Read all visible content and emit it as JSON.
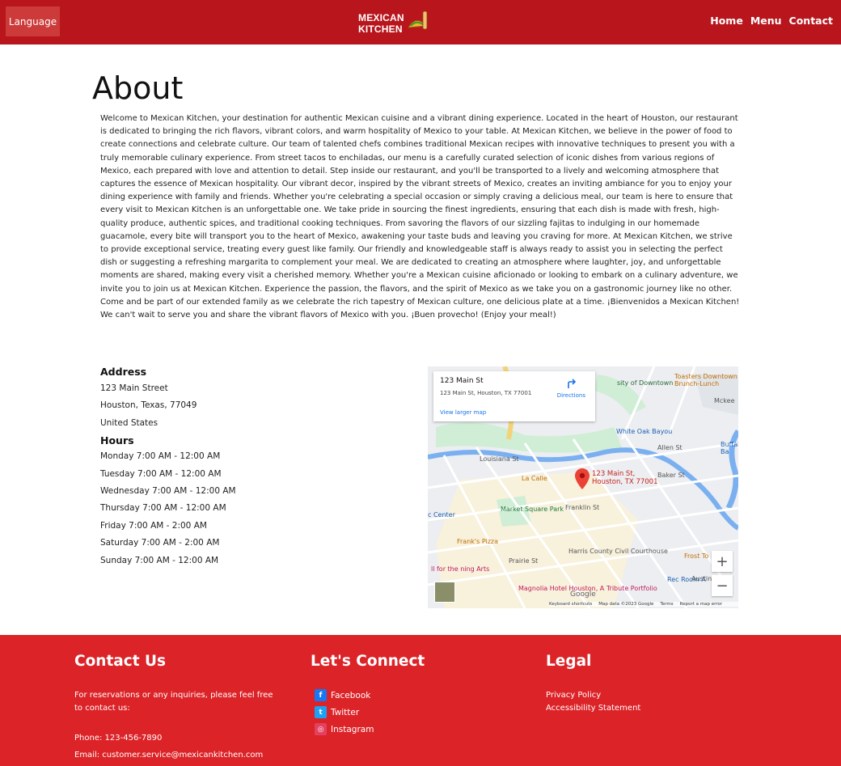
{
  "nav": {
    "language_label": "Language",
    "logo_line1": "MEXICAN",
    "logo_line2": "KITCHEN",
    "links": [
      "Home",
      "Menu",
      "Contact"
    ]
  },
  "about": {
    "title": "About",
    "body": "Welcome to Mexican Kitchen, your destination for authentic Mexican cuisine and a vibrant dining experience. Located in the heart of Houston, our restaurant is dedicated to bringing the rich flavors, vibrant colors, and warm hospitality of Mexico to your table. At Mexican Kitchen, we believe in the power of food to create connections and celebrate culture. Our team of talented chefs combines traditional Mexican recipes with innovative techniques to present you with a truly memorable culinary experience. From street tacos to enchiladas, our menu is a carefully curated selection of iconic dishes from various regions of Mexico, each prepared with love and attention to detail. Step inside our restaurant, and you'll be transported to a lively and welcoming atmosphere that captures the essence of Mexican hospitality. Our vibrant decor, inspired by the vibrant streets of Mexico, creates an inviting ambiance for you to enjoy your dining experience with family and friends. Whether you're celebrating a special occasion or simply craving a delicious meal, our team is here to ensure that every visit to Mexican Kitchen is an unforgettable one. We take pride in sourcing the finest ingredients, ensuring that each dish is made with fresh, high-quality produce, authentic spices, and traditional cooking techniques. From savoring the flavors of our sizzling fajitas to indulging in our homemade guacamole, every bite will transport you to the heart of Mexico, awakening your taste buds and leaving you craving for more. At Mexican Kitchen, we strive to provide exceptional service, treating every guest like family. Our friendly and knowledgeable staff is always ready to assist you in selecting the perfect dish or suggesting a refreshing margarita to complement your meal. We are dedicated to creating an atmosphere where laughter, joy, and unforgettable moments are shared, making every visit a cherished memory. Whether you're a Mexican cuisine aficionado or looking to embark on a culinary adventure, we invite you to join us at Mexican Kitchen. Experience the passion, the flavors, and the spirit of Mexico as we take you on a gastronomic journey like no other. Come and be part of our extended family as we celebrate the rich tapestry of Mexican culture, one delicious plate at a time. ¡Bienvenidos a Mexican Kitchen! We can't wait to serve you and share the vibrant flavors of Mexico with you. ¡Buen provecho! (Enjoy your meal!)"
  },
  "address": {
    "heading": "Address",
    "lines": [
      "123 Main Street",
      "Houston, Texas, 77049",
      "United States"
    ]
  },
  "hours": {
    "heading": "Hours",
    "lines": [
      "Monday 7:00 AM - 12:00 AM",
      "Tuesday 7:00 AM - 12:00 AM",
      "Wednesday 7:00 AM - 12:00 AM",
      "Thursday 7:00 AM - 12:00 AM",
      "Friday 7:00 AM - 2:00 AM",
      "Saturday 7:00 AM - 2:00 AM",
      "Sunday 7:00 AM - 12:00 AM"
    ]
  },
  "map": {
    "card_name": "123 Main St",
    "card_address": "123 Main St, Houston, TX 77001",
    "directions": "Directions",
    "view_larger": "View larger map",
    "pin_label_1": "123 Main St,",
    "pin_label_2": "Houston, TX 77001",
    "labels": {
      "downtown": "sity of Downtown",
      "white_oak": "White Oak Bayou",
      "la_calle": "La Calle",
      "market_square": "Market Square Park",
      "franks": "Frank's Pizza",
      "harris": "Harris County Civil Courthouse",
      "magnolia": "Magnolia Hotel Houston, A Tribute Portfolio",
      "toasters": "Toasters Downtown Brunch-Lunch",
      "frost": "Frost To",
      "rec_room": "Rec Room A",
      "center": "c Center",
      "performing": "ll for the ning Arts",
      "mckee": "Mckee",
      "allen": "Allen St",
      "baker": "Baker St",
      "franklin": "Franklin St",
      "prairie": "Prairie St",
      "austin": "Austin St",
      "louisiana": "Louisiana St",
      "buffalo": "Buffalo Ba"
    },
    "zoom_in": "+",
    "zoom_out": "−",
    "footer": [
      "Keyboard shortcuts",
      "Map data ©2023 Google",
      "Terms",
      "Report a map error"
    ],
    "google": "Google"
  },
  "footer": {
    "contact_heading": "Contact Us",
    "contact_text": "For reservations or any inquiries, please feel free to contact us:",
    "phone": "Phone: 123-456-7890",
    "email": "Email: customer.service@mexicankitchen.com",
    "connect_heading": "Let's Connect",
    "social": [
      "Facebook",
      "Twitter",
      "Instagram"
    ],
    "legal_heading": "Legal",
    "legal_links": [
      "Privacy Policy",
      "Accessibility Statement"
    ]
  },
  "colors": {
    "nav_bg": "#b8151c",
    "footer_bg": "#dc2328",
    "facebook": "#1877f2",
    "twitter": "#1da1f2",
    "instagram": "#e4405f"
  }
}
